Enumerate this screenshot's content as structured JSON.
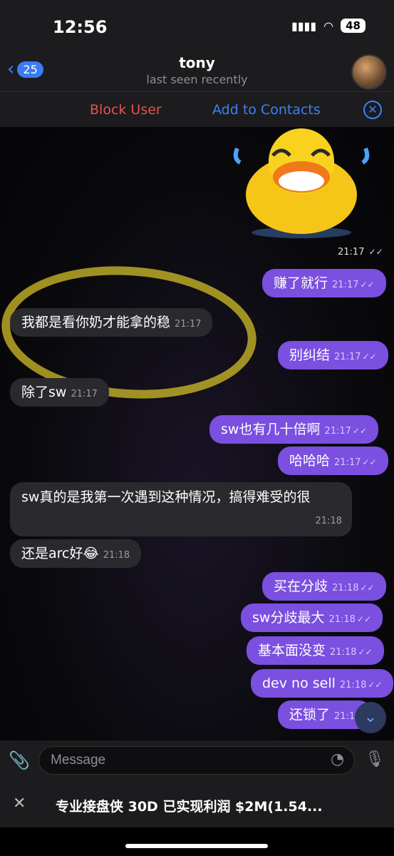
{
  "status": {
    "time": "12:56",
    "battery": "48"
  },
  "header": {
    "back_count": "25",
    "title": "tony",
    "subtitle": "last seen recently"
  },
  "actions": {
    "block": "Block User",
    "add": "Add to Contacts"
  },
  "messages": [
    {
      "dir": "out",
      "text": "赚了就行",
      "time": "21:17"
    },
    {
      "dir": "in",
      "text": "我都是看你奶才能拿的稳",
      "time": "21:17"
    },
    {
      "dir": "out",
      "text": "别纠结",
      "time": "21:17"
    },
    {
      "dir": "in",
      "text": "除了sw",
      "time": "21:17"
    },
    {
      "dir": "out",
      "text": "sw也有几十倍啊",
      "time": "21:17"
    },
    {
      "dir": "out",
      "text": "哈哈哈",
      "time": "21:17"
    },
    {
      "dir": "in",
      "text": "sw真的是我第一次遇到这种情况，搞得难受的很",
      "time": "21:18"
    },
    {
      "dir": "in",
      "text": "还是arc好😂",
      "time": "21:18"
    },
    {
      "dir": "out",
      "text": "买在分歧",
      "time": "21:18"
    },
    {
      "dir": "out",
      "text": "sw分歧最大",
      "time": "21:18"
    },
    {
      "dir": "out",
      "text": "基本面没变",
      "time": "21:18"
    },
    {
      "dir": "out",
      "text": "dev no sell",
      "time": "21:18"
    },
    {
      "dir": "out",
      "text": "还锁了",
      "time": "21:18"
    }
  ],
  "sticker": {
    "time": "21:17"
  },
  "composer": {
    "placeholder": "Message"
  },
  "banner": {
    "text": "专业接盘侠 30D 已实现利润 $2M(1.54..."
  },
  "colors": {
    "outgoing": "#7b4fe0",
    "incoming": "#2a2a2e",
    "accent": "#3b82f6",
    "danger": "#e5534b"
  }
}
